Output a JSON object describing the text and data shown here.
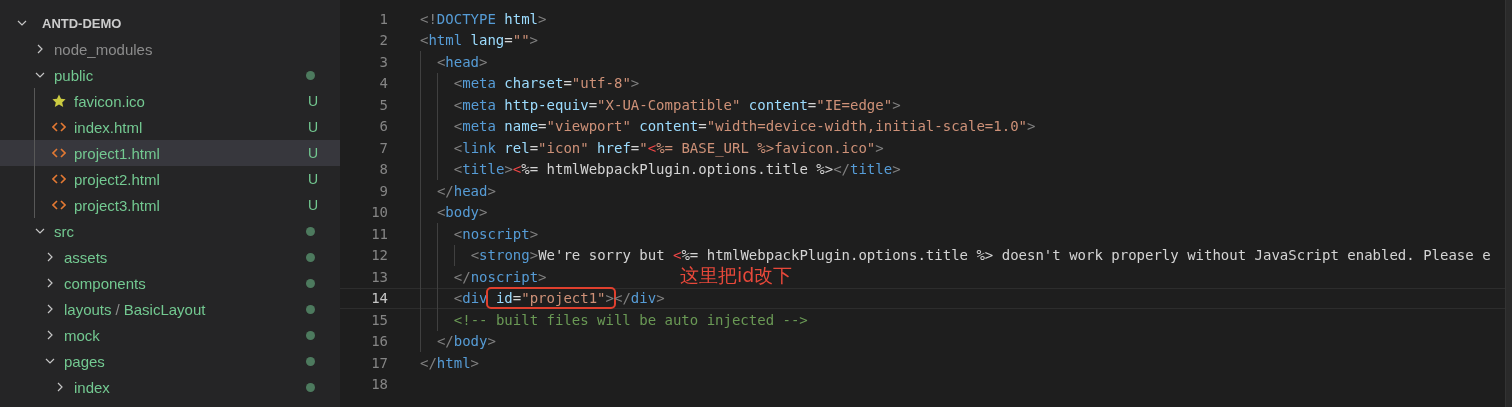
{
  "explorer": {
    "root": {
      "name": "ANTD-DEMO",
      "expanded": true
    },
    "items": [
      {
        "name": "node_modules",
        "kind": "folder",
        "expanded": false,
        "ignored": true,
        "selected": false
      },
      {
        "name": "public",
        "kind": "folder",
        "expanded": true,
        "ignored": false,
        "selected": false,
        "modified_dot": true,
        "children": [
          {
            "name": "favicon.ico",
            "kind": "star-file",
            "ignored": false,
            "selected": false,
            "badge": "U"
          },
          {
            "name": "index.html",
            "kind": "html-file",
            "ignored": false,
            "selected": false,
            "badge": "U"
          },
          {
            "name": "project1.html",
            "kind": "html-file",
            "ignored": false,
            "selected": true,
            "badge": "U"
          },
          {
            "name": "project2.html",
            "kind": "html-file",
            "ignored": false,
            "selected": false,
            "badge": "U"
          },
          {
            "name": "project3.html",
            "kind": "html-file",
            "ignored": false,
            "selected": false,
            "badge": "U"
          }
        ]
      },
      {
        "name": "src",
        "kind": "folder",
        "expanded": true,
        "ignored": false,
        "selected": false,
        "modified_dot": true,
        "children": [
          {
            "name": "assets",
            "kind": "folder",
            "expanded": false,
            "ignored": false,
            "selected": false,
            "modified_dot": true
          },
          {
            "name": "components",
            "kind": "folder",
            "expanded": false,
            "ignored": false,
            "selected": false,
            "modified_dot": true
          },
          {
            "name": "layouts",
            "separator": "/",
            "subfolder": "BasicLayout",
            "kind": "folder",
            "expanded": false,
            "ignored": false,
            "selected": false,
            "modified_dot": true
          },
          {
            "name": "mock",
            "kind": "folder",
            "expanded": false,
            "ignored": false,
            "selected": false,
            "modified_dot": true
          },
          {
            "name": "pages",
            "kind": "folder",
            "expanded": true,
            "ignored": false,
            "selected": false,
            "modified_dot": true,
            "children": [
              {
                "name": "index",
                "kind": "folder",
                "expanded": false,
                "ignored": false,
                "selected": false,
                "modified_dot": true
              }
            ]
          }
        ]
      }
    ]
  },
  "editor": {
    "lines": [
      {
        "number": "1",
        "current": false,
        "tokens": [
          {
            "kind": "punct",
            "text": "<!"
          },
          {
            "kind": "tag",
            "text": "DOCTYPE"
          },
          {
            "kind": "attr",
            "text": " html"
          },
          {
            "kind": "punct",
            "text": ">"
          }
        ]
      },
      {
        "number": "2",
        "current": false,
        "tokens": [
          {
            "kind": "punct",
            "text": "<"
          },
          {
            "kind": "tag",
            "text": "html"
          },
          {
            "kind": "attr",
            "text": " lang"
          },
          {
            "kind": "text",
            "text": "="
          },
          {
            "kind": "string",
            "text": "\"\""
          },
          {
            "kind": "punct",
            "text": ">"
          }
        ],
        "children": [
          {
            "number": "3",
            "current": false,
            "tokens": [
              {
                "kind": "punct",
                "text": "<"
              },
              {
                "kind": "tag",
                "text": "head"
              },
              {
                "kind": "punct",
                "text": ">"
              }
            ],
            "children": [
              {
                "number": "4",
                "current": false,
                "tokens": [
                  {
                    "kind": "punct",
                    "text": "<"
                  },
                  {
                    "kind": "tag",
                    "text": "meta"
                  },
                  {
                    "kind": "attr",
                    "text": " charset"
                  },
                  {
                    "kind": "text",
                    "text": "="
                  },
                  {
                    "kind": "string",
                    "text": "\"utf-8\""
                  },
                  {
                    "kind": "punct",
                    "text": ">"
                  }
                ]
              },
              {
                "number": "5",
                "current": false,
                "tokens": [
                  {
                    "kind": "punct",
                    "text": "<"
                  },
                  {
                    "kind": "tag",
                    "text": "meta"
                  },
                  {
                    "kind": "attr",
                    "text": " http-equiv"
                  },
                  {
                    "kind": "text",
                    "text": "="
                  },
                  {
                    "kind": "string",
                    "text": "\"X-UA-Compatible\""
                  },
                  {
                    "kind": "attr",
                    "text": " content"
                  },
                  {
                    "kind": "text",
                    "text": "="
                  },
                  {
                    "kind": "string",
                    "text": "\"IE=edge\""
                  },
                  {
                    "kind": "punct",
                    "text": ">"
                  }
                ]
              },
              {
                "number": "6",
                "current": false,
                "tokens": [
                  {
                    "kind": "punct",
                    "text": "<"
                  },
                  {
                    "kind": "tag",
                    "text": "meta"
                  },
                  {
                    "kind": "attr",
                    "text": " name"
                  },
                  {
                    "kind": "text",
                    "text": "="
                  },
                  {
                    "kind": "string",
                    "text": "\"viewport\""
                  },
                  {
                    "kind": "attr",
                    "text": " content"
                  },
                  {
                    "kind": "text",
                    "text": "="
                  },
                  {
                    "kind": "string",
                    "text": "\"width=device-width,initial-scale=1.0\""
                  },
                  {
                    "kind": "punct",
                    "text": ">"
                  }
                ]
              },
              {
                "number": "7",
                "current": false,
                "tokens": [
                  {
                    "kind": "punct",
                    "text": "<"
                  },
                  {
                    "kind": "tag",
                    "text": "link"
                  },
                  {
                    "kind": "attr",
                    "text": " rel"
                  },
                  {
                    "kind": "text",
                    "text": "="
                  },
                  {
                    "kind": "string",
                    "text": "\"icon\""
                  },
                  {
                    "kind": "attr",
                    "text": " href"
                  },
                  {
                    "kind": "text",
                    "text": "="
                  },
                  {
                    "kind": "string",
                    "text": "\""
                  },
                  {
                    "kind": "error",
                    "text": "<"
                  },
                  {
                    "kind": "string",
                    "text": "%= BASE_URL %>favicon.ico\""
                  },
                  {
                    "kind": "punct",
                    "text": ">"
                  }
                ]
              },
              {
                "number": "8",
                "current": false,
                "tokens": [
                  {
                    "kind": "punct",
                    "text": "<"
                  },
                  {
                    "kind": "tag",
                    "text": "title"
                  },
                  {
                    "kind": "punct",
                    "text": ">"
                  },
                  {
                    "kind": "error",
                    "text": "<"
                  },
                  {
                    "kind": "text",
                    "text": "%= htmlWebpackPlugin.options.title %>"
                  },
                  {
                    "kind": "punct",
                    "text": "</"
                  },
                  {
                    "kind": "tag",
                    "text": "title"
                  },
                  {
                    "kind": "punct",
                    "text": ">"
                  }
                ]
              }
            ]
          },
          {
            "number": "9",
            "current": false,
            "tokens": [
              {
                "kind": "punct",
                "text": "</"
              },
              {
                "kind": "tag",
                "text": "head"
              },
              {
                "kind": "punct",
                "text": ">"
              }
            ]
          },
          {
            "number": "10",
            "current": false,
            "tokens": [
              {
                "kind": "punct",
                "text": "<"
              },
              {
                "kind": "tag",
                "text": "body"
              },
              {
                "kind": "punct",
                "text": ">"
              }
            ],
            "children": [
              {
                "number": "11",
                "current": false,
                "tokens": [
                  {
                    "kind": "punct",
                    "text": "<"
                  },
                  {
                    "kind": "tag",
                    "text": "noscript"
                  },
                  {
                    "kind": "punct",
                    "text": ">"
                  }
                ],
                "children": [
                  {
                    "number": "12",
                    "current": false,
                    "tokens": [
                      {
                        "kind": "punct",
                        "text": "<"
                      },
                      {
                        "kind": "tag",
                        "text": "strong"
                      },
                      {
                        "kind": "punct",
                        "text": ">"
                      },
                      {
                        "kind": "text",
                        "text": "We're sorry but "
                      },
                      {
                        "kind": "error",
                        "text": "<"
                      },
                      {
                        "kind": "text",
                        "text": "%= htmlWebpackPlugin.options.title %> doesn't work properly without JavaScript enabled. Please e"
                      }
                    ]
                  }
                ]
              },
              {
                "number": "13",
                "current": false,
                "tokens": [
                  {
                    "kind": "punct",
                    "text": "</"
                  },
                  {
                    "kind": "tag",
                    "text": "noscript"
                  },
                  {
                    "kind": "punct",
                    "text": ">"
                  }
                ]
              },
              {
                "number": "14",
                "current": true,
                "note": "这里把id改下",
                "tokens": [
                  {
                    "kind": "punct",
                    "text": "<"
                  },
                  {
                    "kind": "tag",
                    "text": "div"
                  },
                  {
                    "kind": "attr",
                    "text": " id",
                    "annotated": true
                  },
                  {
                    "kind": "text",
                    "text": "=",
                    "annotated": true
                  },
                  {
                    "kind": "string",
                    "text": "\"project1\"",
                    "annotated": true
                  },
                  {
                    "kind": "punct",
                    "text": ">",
                    "annotated": true
                  },
                  {
                    "kind": "punct",
                    "text": "</"
                  },
                  {
                    "kind": "tag",
                    "text": "div"
                  },
                  {
                    "kind": "punct",
                    "text": ">"
                  }
                ]
              },
              {
                "number": "15",
                "current": false,
                "tokens": [
                  {
                    "kind": "comment",
                    "text": "<!-- built files will be auto injected -->"
                  }
                ]
              }
            ]
          },
          {
            "number": "16",
            "current": false,
            "tokens": [
              {
                "kind": "punct",
                "text": "</"
              },
              {
                "kind": "tag",
                "text": "body"
              },
              {
                "kind": "punct",
                "text": ">"
              }
            ]
          }
        ]
      },
      {
        "number": "17",
        "current": false,
        "tokens": [
          {
            "kind": "punct",
            "text": "</"
          },
          {
            "kind": "tag",
            "text": "html"
          },
          {
            "kind": "punct",
            "text": ">"
          }
        ]
      },
      {
        "number": "18",
        "current": false
      }
    ]
  }
}
